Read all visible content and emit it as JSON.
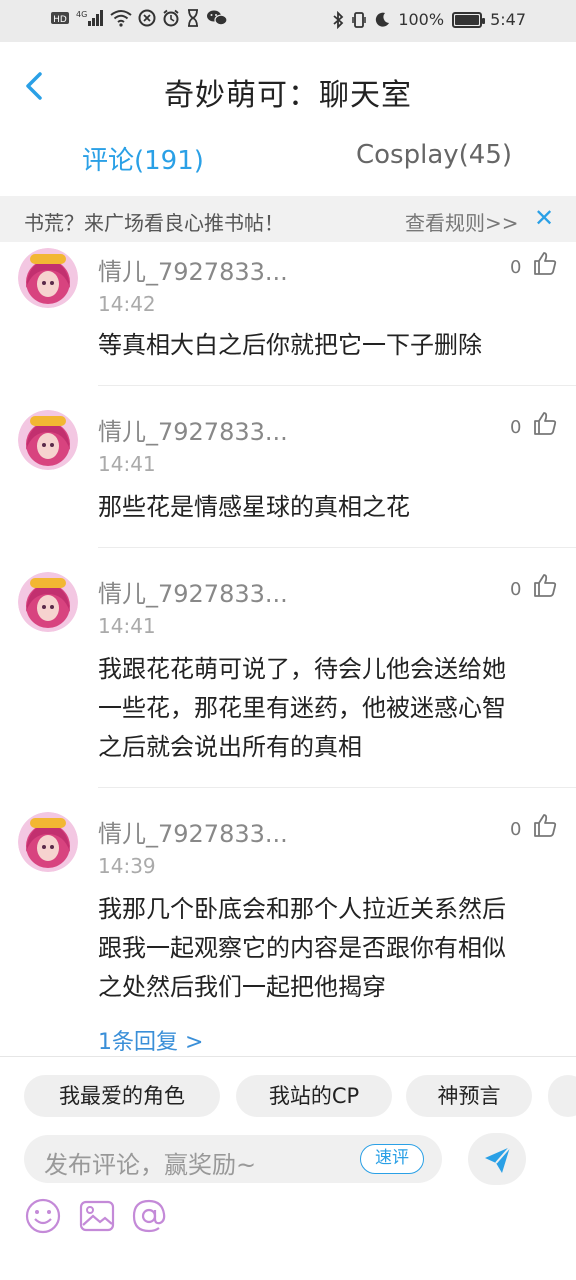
{
  "status_bar": {
    "left_icons": [
      "hd-icon",
      "4g-signal-icon",
      "wifi-icon",
      "app-icon",
      "alarm-icon",
      "hourglass-icon",
      "wechat-icon"
    ],
    "battery": "100%",
    "battery_level": 1.0,
    "time": "5:47"
  },
  "header": {
    "title": "奇妙萌可：聊天室"
  },
  "tabs": [
    {
      "label": "评论(191)",
      "active": true
    },
    {
      "label": "Cosplay(45)",
      "active": false
    }
  ],
  "notice": {
    "text": "书荒？来广场看良心推书帖！",
    "rule_link": "查看规则>>",
    "close": "✕"
  },
  "comments": [
    {
      "name": "情儿_7927833...",
      "time": "14:42",
      "likes": "0",
      "text": [
        "等真相大白之后你就把它一下子删除"
      ]
    },
    {
      "name": "情儿_7927833...",
      "time": "14:41",
      "likes": "0",
      "text": [
        "那些花是情感星球的真相之花"
      ]
    },
    {
      "name": "情儿_7927833...",
      "time": "14:41",
      "likes": "0",
      "text": [
        "我跟花花萌可说了，待会儿他会送给她",
        "一些花，那花里有迷药，他被迷惑心智",
        "之后就会说出所有的真相"
      ]
    },
    {
      "name": "情儿_7927833...",
      "time": "14:39",
      "likes": "0",
      "text": [
        "我那几个卧底会和那个人拉近关系然后",
        "跟我一起观察它的内容是否跟你有相似",
        "之处然后我们一起把他揭穿"
      ],
      "reply_link": "1条回复 >"
    }
  ],
  "quick_tags": [
    "我最爱的角色",
    "我站的CP",
    "神预言"
  ],
  "composer": {
    "placeholder": "发布评论，赢奖励~",
    "quick_review": "速评"
  },
  "toolbar_icons": [
    "emoji-icon",
    "image-icon",
    "mention-icon"
  ],
  "colors": {
    "accent": "#2aa0e6",
    "toolbar_icon": "#c48ad8",
    "status_bar_bg": "#ebebeb"
  }
}
